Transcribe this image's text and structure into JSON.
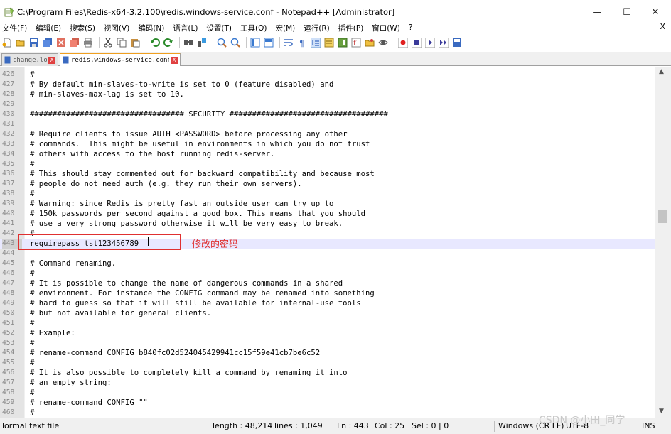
{
  "window": {
    "title": "C:\\Program Files\\Redis-x64-3.2.100\\redis.windows-service.conf - Notepad++ [Administrator]",
    "minimize": "—",
    "maximize": "☐",
    "close": "✕"
  },
  "menu": {
    "items": [
      "文件(F)",
      "编辑(E)",
      "搜索(S)",
      "视图(V)",
      "编码(N)",
      "语言(L)",
      "设置(T)",
      "工具(O)",
      "宏(M)",
      "运行(R)",
      "插件(P)",
      "窗口(W)",
      "?"
    ],
    "close": "X"
  },
  "toolbar": {
    "icons": [
      "new-file-icon",
      "open-file-icon",
      "save-icon",
      "save-all-icon",
      "close-icon",
      "close-all-icon",
      "print-icon",
      "cut-icon",
      "copy-icon",
      "paste-icon",
      "undo-icon",
      "redo-icon",
      "find-icon",
      "replace-icon",
      "zoom-in-icon",
      "zoom-out-icon",
      "sync-v-icon",
      "sync-h-icon",
      "wrap-icon",
      "all-chars-icon",
      "indent-guide-icon",
      "udl-icon",
      "doc-map-icon",
      "func-list-icon",
      "folder-workspace-icon",
      "monitor-icon",
      "record-macro-icon",
      "stop-macro-icon",
      "play-macro-icon",
      "run-macro-icon",
      "save-macro-icon"
    ]
  },
  "tabs": [
    {
      "label": "change.log",
      "active": false,
      "close": "X"
    },
    {
      "label": "redis.windows-service.conf",
      "active": true,
      "close": "X"
    }
  ],
  "editor": {
    "current_line": 443,
    "lines": [
      {
        "n": "426",
        "t": "#"
      },
      {
        "n": "427",
        "t": "# By default min-slaves-to-write is set to 0 (feature disabled) and"
      },
      {
        "n": "428",
        "t": "# min-slaves-max-lag is set to 10."
      },
      {
        "n": "429",
        "t": ""
      },
      {
        "n": "430",
        "t": "################################## SECURITY ###################################"
      },
      {
        "n": "431",
        "t": ""
      },
      {
        "n": "432",
        "t": "# Require clients to issue AUTH <PASSWORD> before processing any other"
      },
      {
        "n": "433",
        "t": "# commands.  This might be useful in environments in which you do not trust"
      },
      {
        "n": "434",
        "t": "# others with access to the host running redis-server."
      },
      {
        "n": "435",
        "t": "#"
      },
      {
        "n": "436",
        "t": "# This should stay commented out for backward compatibility and because most"
      },
      {
        "n": "437",
        "t": "# people do not need auth (e.g. they run their own servers)."
      },
      {
        "n": "438",
        "t": "#"
      },
      {
        "n": "439",
        "t": "# Warning: since Redis is pretty fast an outside user can try up to"
      },
      {
        "n": "440",
        "t": "# 150k passwords per second against a good box. This means that you should"
      },
      {
        "n": "441",
        "t": "# use a very strong password otherwise it will be very easy to break."
      },
      {
        "n": "442",
        "t": "#"
      },
      {
        "n": "443",
        "t": "requirepass tst123456789"
      },
      {
        "n": "444",
        "t": ""
      },
      {
        "n": "445",
        "t": "# Command renaming."
      },
      {
        "n": "446",
        "t": "#"
      },
      {
        "n": "447",
        "t": "# It is possible to change the name of dangerous commands in a shared"
      },
      {
        "n": "448",
        "t": "# environment. For instance the CONFIG command may be renamed into something"
      },
      {
        "n": "449",
        "t": "# hard to guess so that it will still be available for internal-use tools"
      },
      {
        "n": "450",
        "t": "# but not available for general clients."
      },
      {
        "n": "451",
        "t": "#"
      },
      {
        "n": "452",
        "t": "# Example:"
      },
      {
        "n": "453",
        "t": "#"
      },
      {
        "n": "454",
        "t": "# rename-command CONFIG b840fc02d524045429941cc15f59e41cb7be6c52"
      },
      {
        "n": "455",
        "t": "#"
      },
      {
        "n": "456",
        "t": "# It is also possible to completely kill a command by renaming it into"
      },
      {
        "n": "457",
        "t": "# an empty string:"
      },
      {
        "n": "458",
        "t": "#"
      },
      {
        "n": "459",
        "t": "# rename-command CONFIG \"\""
      },
      {
        "n": "460",
        "t": "#"
      }
    ]
  },
  "annotation": {
    "text": "修改的密码",
    "color": "#e03030"
  },
  "status": {
    "file_type": "lormal text file",
    "length": "length : 48,214",
    "lines": "lines : 1,049",
    "ln": "Ln : 443",
    "col": "Col : 25",
    "sel": "Sel : 0 | 0",
    "eol": "Windows (CR LF)",
    "encoding": "UTF-8",
    "ins": "INS"
  },
  "watermark": "CSDN @小田_同学"
}
